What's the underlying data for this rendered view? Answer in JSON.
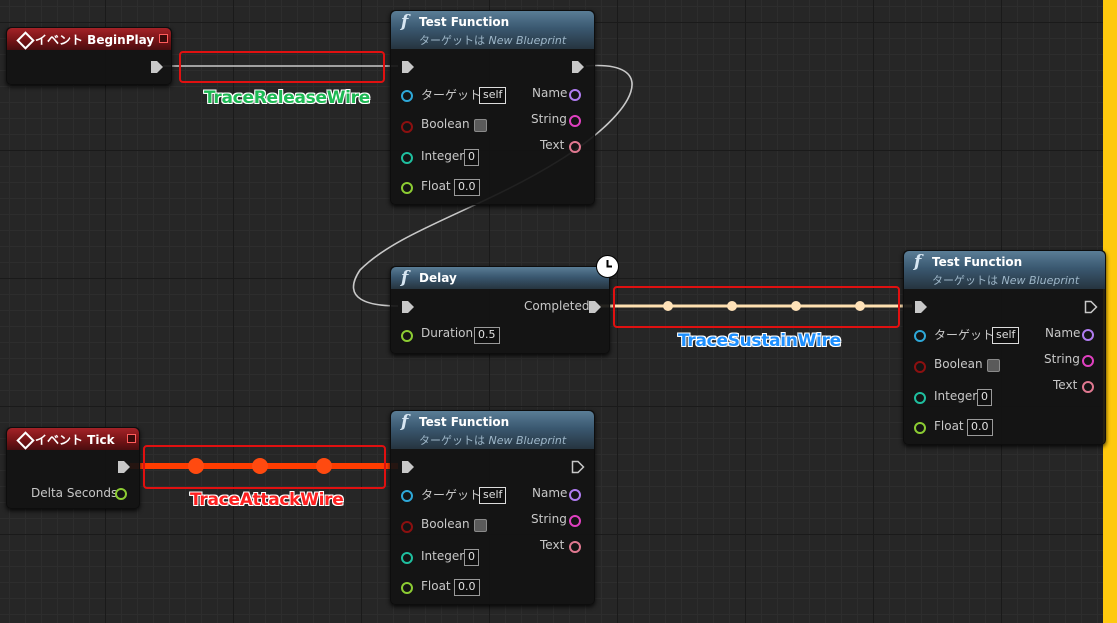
{
  "event_begin_play": {
    "title": "イベント BeginPlay"
  },
  "event_tick": {
    "title": "イベント Tick",
    "pin_delta_seconds": "Delta Seconds"
  },
  "test_function_1": {
    "title": "Test Function",
    "subtitle_prefix": "ターゲットは",
    "subtitle_target": "New Blueprint",
    "inputs": {
      "target": "ターゲット",
      "target_value": "self",
      "boolean": "Boolean",
      "integer": "Integer",
      "integer_value": "0",
      "float": "Float",
      "float_value": "0.0"
    },
    "outputs": {
      "name": "Name",
      "string": "String",
      "text": "Text"
    }
  },
  "delay": {
    "title": "Delay",
    "completed": "Completed",
    "duration": "Duration",
    "duration_value": "0.5"
  },
  "test_function_2": {
    "title": "Test Function",
    "subtitle_prefix": "ターゲットは",
    "subtitle_target": "New Blueprint",
    "inputs": {
      "target": "ターゲット",
      "target_value": "self",
      "boolean": "Boolean",
      "integer": "Integer",
      "integer_value": "0",
      "float": "Float",
      "float_value": "0.0"
    },
    "outputs": {
      "name": "Name",
      "string": "String",
      "text": "Text"
    }
  },
  "test_function_3": {
    "title": "Test Function",
    "subtitle_prefix": "ターゲットは",
    "subtitle_target": "New Blueprint",
    "inputs": {
      "target": "ターゲット",
      "target_value": "self",
      "boolean": "Boolean",
      "integer": "Integer",
      "integer_value": "0",
      "float": "Float",
      "float_value": "0.0"
    },
    "outputs": {
      "name": "Name",
      "string": "String",
      "text": "Text"
    }
  },
  "annotations": {
    "release": {
      "label": "TraceReleaseWire",
      "color": "#1db954"
    },
    "sustain": {
      "label": "TraceSustainWire",
      "color": "#1e90ff"
    },
    "attack": {
      "label": "TraceAttackWire",
      "color": "#ff2020"
    }
  },
  "colors": {
    "exec_pin": "#ffffff",
    "target_pin": "#2ea8d8",
    "bool_pin": "#8c1010",
    "int_pin": "#1fbf9f",
    "float_pin": "#8ccc33",
    "name_pin": "#b07cf0",
    "string_pin": "#e040c0",
    "text_pin": "#e07890",
    "highlight": "#e01010"
  }
}
